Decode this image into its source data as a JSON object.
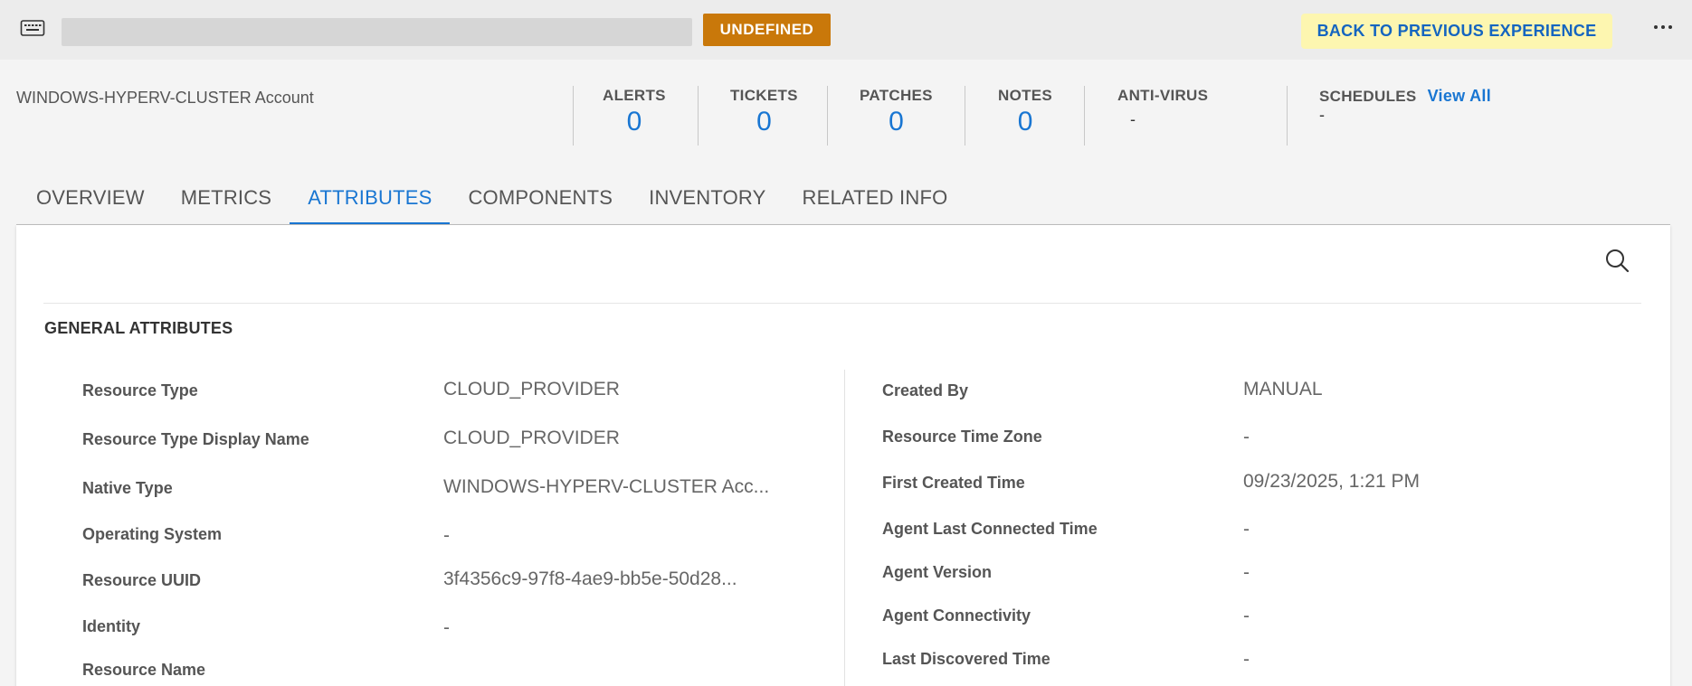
{
  "topbar": {
    "status_badge": "UNDEFINED",
    "back_button": "BACK TO PREVIOUS EXPERIENCE"
  },
  "header": {
    "account_name": "WINDOWS-HYPERV-CLUSTER Account",
    "stats": {
      "alerts": {
        "label": "ALERTS",
        "value": "0"
      },
      "tickets": {
        "label": "TICKETS",
        "value": "0"
      },
      "patches": {
        "label": "PATCHES",
        "value": "0"
      },
      "notes": {
        "label": "NOTES",
        "value": "0"
      },
      "antivirus": {
        "label": "ANTI-VIRUS",
        "value": "-"
      },
      "schedules": {
        "label": "SCHEDULES",
        "value": "-",
        "link": "View All"
      }
    }
  },
  "tabs": [
    {
      "label": "OVERVIEW"
    },
    {
      "label": "METRICS"
    },
    {
      "label": "ATTRIBUTES"
    },
    {
      "label": "COMPONENTS"
    },
    {
      "label": "INVENTORY"
    },
    {
      "label": "RELATED INFO"
    }
  ],
  "active_tab": "ATTRIBUTES",
  "section": {
    "title": "GENERAL ATTRIBUTES"
  },
  "attributes_left": [
    {
      "label": "Resource Type",
      "value": "CLOUD_PROVIDER"
    },
    {
      "label": "Resource Type Display Name",
      "value": "CLOUD_PROVIDER"
    },
    {
      "label": "Native Type",
      "value": "WINDOWS-HYPERV-CLUSTER Acc..."
    },
    {
      "label": "Operating System",
      "value": "-"
    },
    {
      "label": "Resource UUID",
      "value": "3f4356c9-97f8-4ae9-bb5e-50d28..."
    },
    {
      "label": "Identity",
      "value": "-"
    },
    {
      "label": "Resource Name",
      "value": ""
    }
  ],
  "attributes_right": [
    {
      "label": "Created By",
      "value": "MANUAL"
    },
    {
      "label": "Resource Time Zone",
      "value": "-"
    },
    {
      "label": "First Created Time",
      "value": "09/23/2025, 1:21 PM"
    },
    {
      "label": "Agent Last Connected Time",
      "value": "-"
    },
    {
      "label": "Agent Version",
      "value": "-"
    },
    {
      "label": "Agent Connectivity",
      "value": "-"
    },
    {
      "label": "Last Discovered Time",
      "value": "-"
    }
  ],
  "colors": {
    "accent": "#1976d2",
    "badge": "#c9780a",
    "back_button_bg": "#fdf6b0"
  },
  "icons": [
    "keyboard-icon",
    "more-horizontal-icon",
    "search-icon"
  ]
}
